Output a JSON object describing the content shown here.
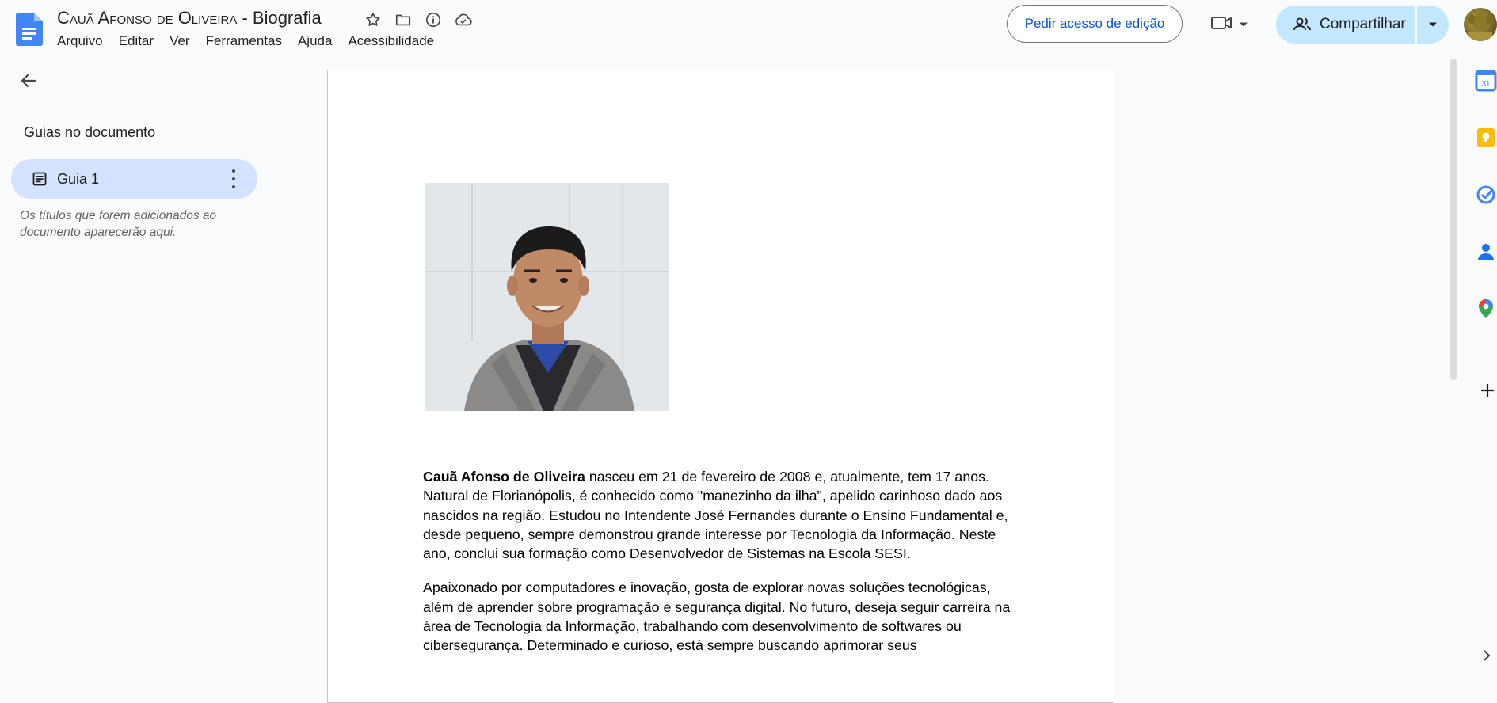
{
  "header": {
    "title_name": "Cauã Afonso de Oliveira",
    "title_suffix": " - Biografia",
    "menus": [
      "Arquivo",
      "Editar",
      "Ver",
      "Ferramentas",
      "Ajuda",
      "Acessibilidade"
    ],
    "request_edit_label": "Pedir acesso de edição",
    "share_label": "Compartilhar"
  },
  "outline": {
    "heading": "Guias no documento",
    "tab_label": "Guia 1",
    "hint": "Os títulos que forem adicionados ao documento aparecerão aqui."
  },
  "document": {
    "p1_bold": "Cauã Afonso de Oliveira",
    "p1_rest": " nasceu em 21 de fevereiro de 2008 e, atualmente, tem 17 anos. Natural de Florianópolis, é conhecido como \"manezinho da ilha\", apelido carinhoso dado aos nascidos na região. Estudou no Intendente José Fernandes durante o Ensino Fundamental e, desde pequeno, sempre demonstrou grande interesse por Tecnologia da Informação. Neste ano, conclui sua formação como Desenvolvedor de Sistemas na Escola SESI.",
    "p2": "Apaixonado por computadores e inovação, gosta de explorar novas soluções tecnológicas, além de aprender sobre programação e segurança digital. No futuro, deseja seguir carreira na área de Tecnologia da Informação, trabalhando com desenvolvimento de softwares ou cibersegurança. Determinado e curioso, está sempre buscando aprimorar seus"
  },
  "side_panel": {
    "calendar_day": "31"
  },
  "colors": {
    "accent": "#0b57d0",
    "share_bg": "#c2e7ff",
    "tab_bg": "#d3e3fd",
    "docs_blue": "#4285f4"
  }
}
